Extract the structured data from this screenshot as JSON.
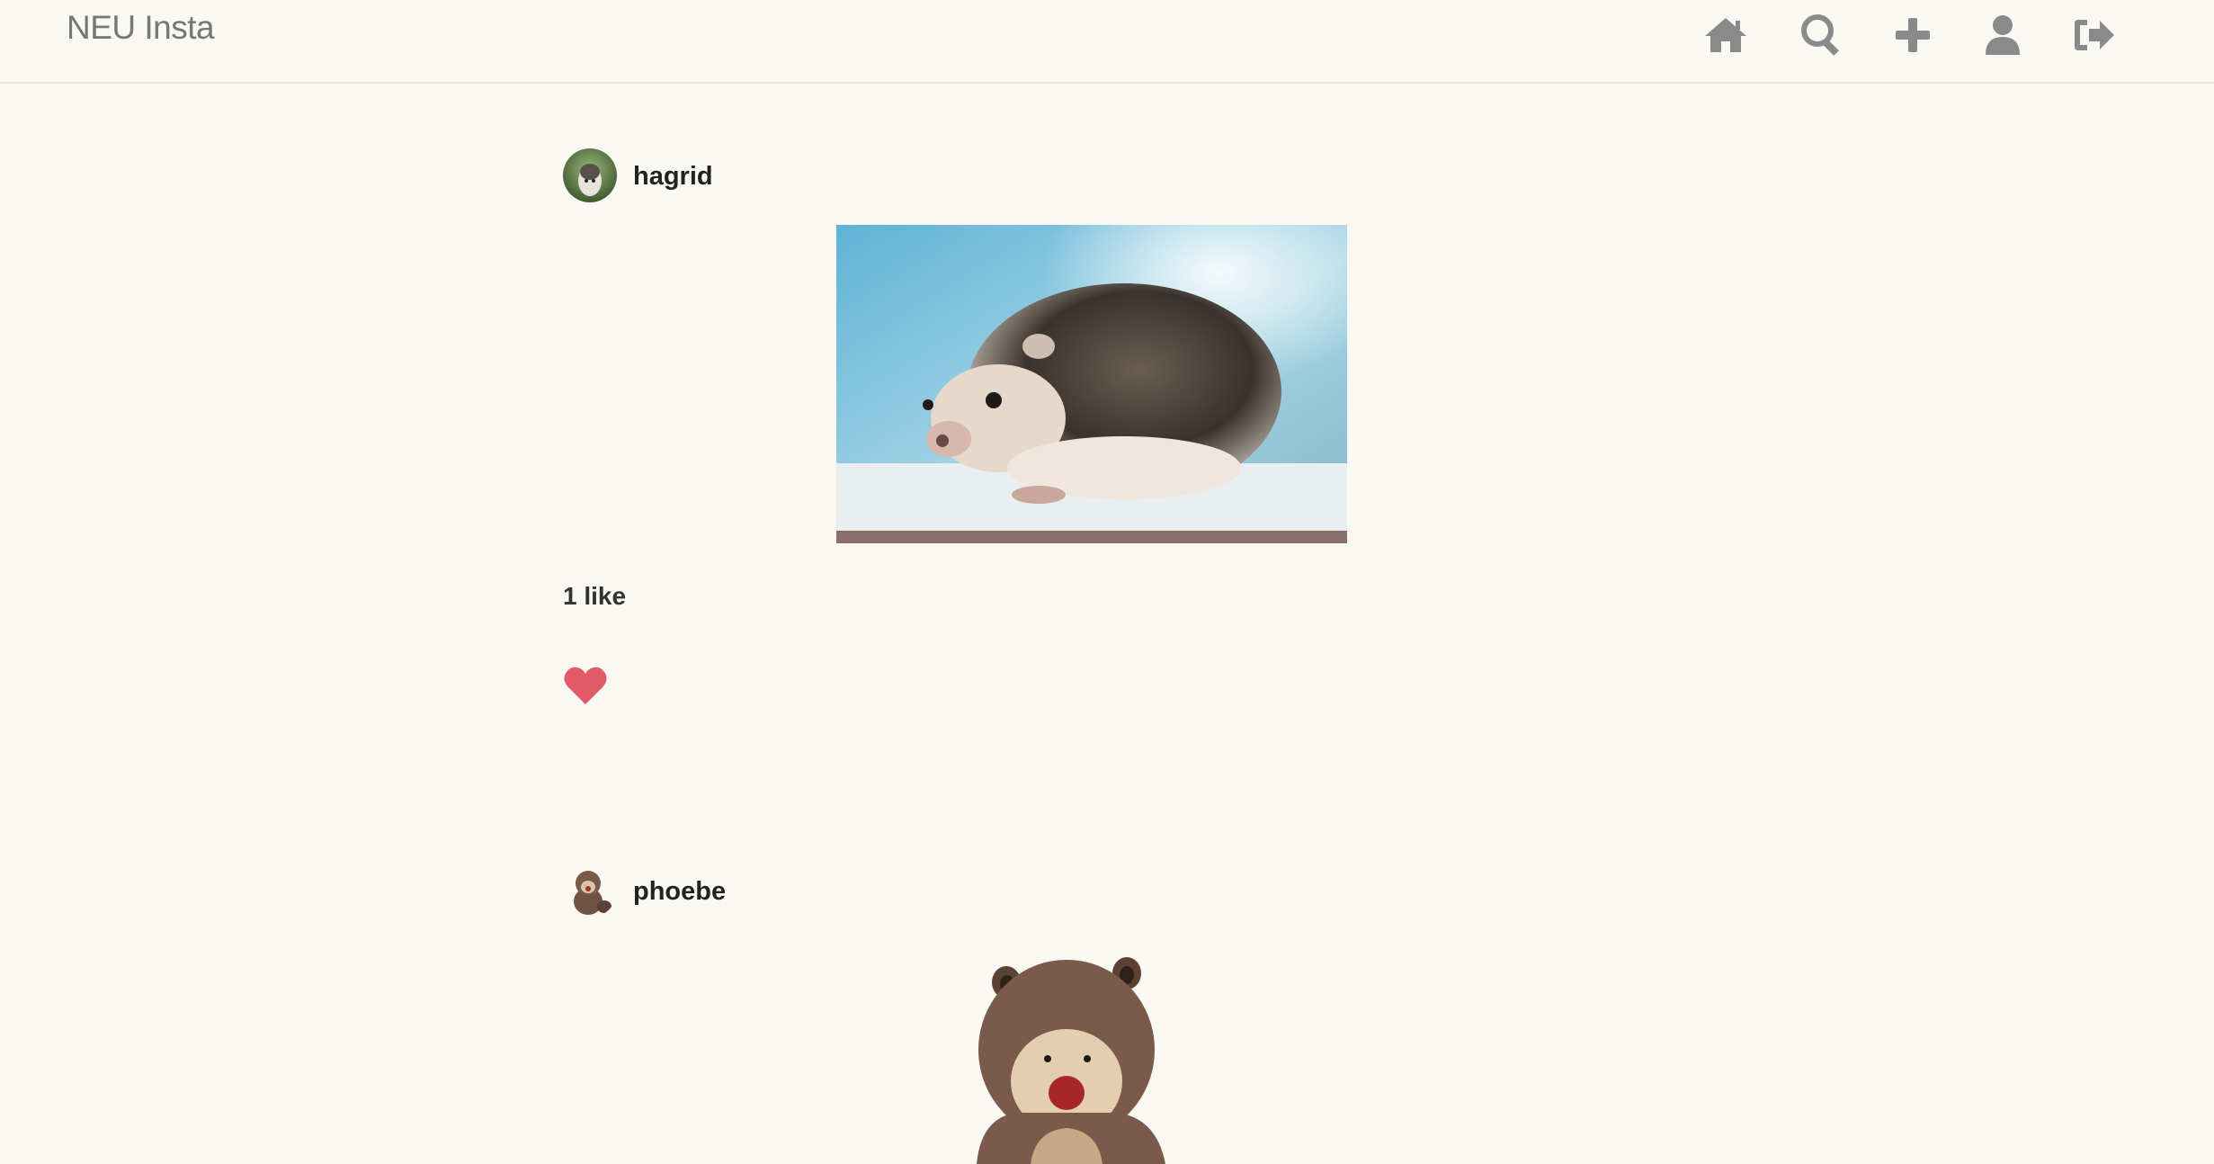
{
  "app": {
    "brand": "NEU Insta"
  },
  "nav": {
    "icons": [
      "home-icon",
      "search-icon",
      "plus-icon",
      "user-icon",
      "sign-out-icon"
    ]
  },
  "posts": [
    {
      "username": "hagrid",
      "likes_text": "1 like",
      "liked": true,
      "image_subject": "hedgehog"
    },
    {
      "username": "phoebe",
      "image_subject": "plush-hedgehog"
    }
  ],
  "colors": {
    "background": "#faf8f2",
    "icon": "#8a8a8a",
    "heart": "#e05a68"
  }
}
